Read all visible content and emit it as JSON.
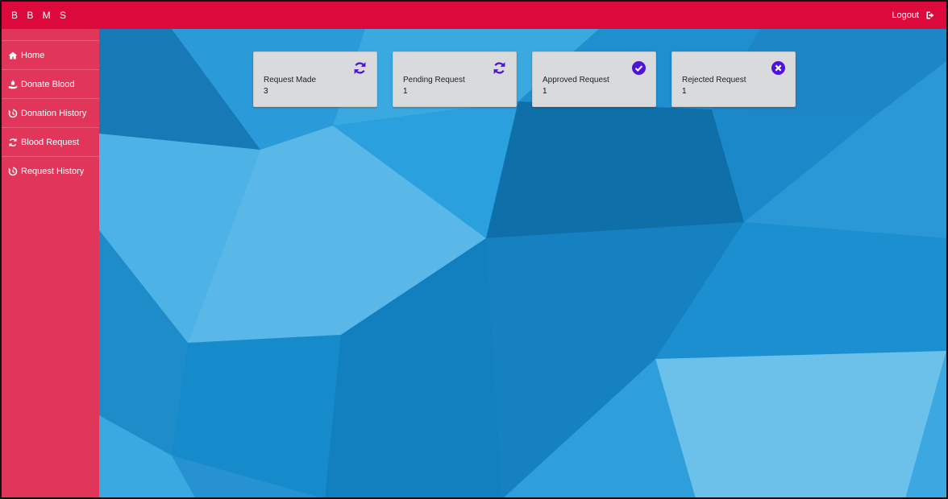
{
  "app": {
    "brand": "B B M S",
    "logout_label": "Logout"
  },
  "sidebar": {
    "items": [
      {
        "label": "Home",
        "icon": "home-icon"
      },
      {
        "label": "Donate Blood",
        "icon": "donate-icon"
      },
      {
        "label": "Donation History",
        "icon": "history-icon"
      },
      {
        "label": "Blood Request",
        "icon": "sync-icon"
      },
      {
        "label": "Request History",
        "icon": "history-icon"
      }
    ]
  },
  "cards": [
    {
      "label": "Request Made",
      "value": "3",
      "icon": "sync-icon"
    },
    {
      "label": "Pending Request",
      "value": "1",
      "icon": "sync-icon"
    },
    {
      "label": "Approved Request",
      "value": "1",
      "icon": "check-circle-icon"
    },
    {
      "label": "Rejected Request",
      "value": "1",
      "icon": "x-circle-icon"
    }
  ],
  "colors": {
    "topbar": "#dc0a3c",
    "sidebar": "#e1365a",
    "card_bg": "#d9dadc",
    "icon_accent": "#4f12d8"
  }
}
